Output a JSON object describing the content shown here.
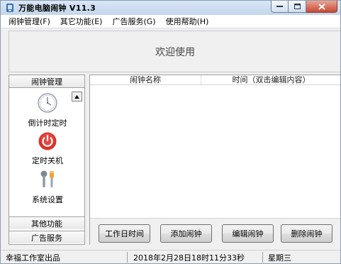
{
  "window": {
    "title": "万能电脑闹钟 V11.3"
  },
  "menu": [
    "闹钟管理(F)",
    "其它功能(E)",
    "广告服务(G)",
    "使用帮助(H)"
  ],
  "banner": {
    "text": "欢迎使用"
  },
  "sidebar": {
    "header": "闹钟管理",
    "items": [
      {
        "label": "倒计时定时",
        "icon": "clock-icon"
      },
      {
        "label": "定时关机",
        "icon": "power-icon"
      },
      {
        "label": "系统设置",
        "icon": "settings-wrench-icon"
      }
    ],
    "footers": [
      "其他功能",
      "广告服务"
    ]
  },
  "table": {
    "columns": [
      "闹钟名称",
      "时间（双击编辑内容）"
    ],
    "rows": []
  },
  "buttons": [
    "工作日时间",
    "添加闹钟",
    "编辑闹钟",
    "删除闹钟"
  ],
  "status": {
    "left": "幸福工作室出品",
    "center": "2018年2月28日18时11分33秒",
    "right": "星期三"
  },
  "colors": {
    "titlebar": "#c4d6ec",
    "close_button": "#c74b36",
    "power_icon": "#d9332b"
  }
}
